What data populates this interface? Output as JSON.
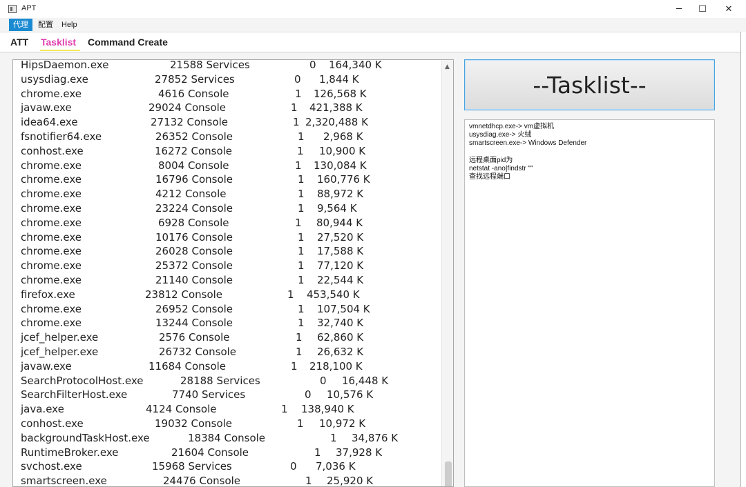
{
  "window": {
    "title": "APT",
    "minimize_glyph": "─",
    "maximize_glyph": "☐",
    "close_glyph": "✕"
  },
  "menu": [
    "代理",
    "配置",
    "Help"
  ],
  "tabs": [
    "ATT",
    "Tasklist",
    "Command Create"
  ],
  "process_list": [
    {
      "name": "HipsDaemon.exe",
      "pid": "21588",
      "session": "Services",
      "num": "0",
      "mem": "164,340 K"
    },
    {
      "name": "usysdiag.exe",
      "pid": "27852",
      "session": "Services",
      "num": "0",
      "mem": "1,844 K"
    },
    {
      "name": "chrome.exe",
      "pid": "4616",
      "session": "Console",
      "num": "1",
      "mem": "126,568 K"
    },
    {
      "name": "javaw.exe",
      "pid": "29024",
      "session": "Console",
      "num": "1",
      "mem": "421,388 K"
    },
    {
      "name": "idea64.exe",
      "pid": "27132",
      "session": "Console",
      "num": "1",
      "mem": "2,320,488 K"
    },
    {
      "name": "fsnotifier64.exe",
      "pid": "26352",
      "session": "Console",
      "num": "1",
      "mem": "2,968 K"
    },
    {
      "name": "conhost.exe",
      "pid": "16272",
      "session": "Console",
      "num": "1",
      "mem": "10,900 K"
    },
    {
      "name": "chrome.exe",
      "pid": "8004",
      "session": "Console",
      "num": "1",
      "mem": "130,084 K"
    },
    {
      "name": "chrome.exe",
      "pid": "16796",
      "session": "Console",
      "num": "1",
      "mem": "160,776 K"
    },
    {
      "name": "chrome.exe",
      "pid": "4212",
      "session": "Console",
      "num": "1",
      "mem": "88,972 K"
    },
    {
      "name": "chrome.exe",
      "pid": "23224",
      "session": "Console",
      "num": "1",
      "mem": "9,564 K"
    },
    {
      "name": "chrome.exe",
      "pid": "6928",
      "session": "Console",
      "num": "1",
      "mem": "80,944 K"
    },
    {
      "name": "chrome.exe",
      "pid": "10176",
      "session": "Console",
      "num": "1",
      "mem": "27,520 K"
    },
    {
      "name": "chrome.exe",
      "pid": "26028",
      "session": "Console",
      "num": "1",
      "mem": "17,588 K"
    },
    {
      "name": "chrome.exe",
      "pid": "25372",
      "session": "Console",
      "num": "1",
      "mem": "77,120 K"
    },
    {
      "name": "chrome.exe",
      "pid": "21140",
      "session": "Console",
      "num": "1",
      "mem": "22,544 K"
    },
    {
      "name": "firefox.exe",
      "pid": "23812",
      "session": "Console",
      "num": "1",
      "mem": "453,540 K"
    },
    {
      "name": "chrome.exe",
      "pid": "26952",
      "session": "Console",
      "num": "1",
      "mem": "107,504 K"
    },
    {
      "name": "chrome.exe",
      "pid": "13244",
      "session": "Console",
      "num": "1",
      "mem": "32,740 K"
    },
    {
      "name": "jcef_helper.exe",
      "pid": "2576",
      "session": "Console",
      "num": "1",
      "mem": "62,860 K"
    },
    {
      "name": "jcef_helper.exe",
      "pid": "26732",
      "session": "Console",
      "num": "1",
      "mem": "26,632 K"
    },
    {
      "name": "javaw.exe",
      "pid": "11684",
      "session": "Console",
      "num": "1",
      "mem": "218,100 K"
    },
    {
      "name": "SearchProtocolHost.exe",
      "pid": "28188",
      "session": "Services",
      "num": "0",
      "mem": "16,448 K"
    },
    {
      "name": "SearchFilterHost.exe",
      "pid": "7740",
      "session": "Services",
      "num": "0",
      "mem": "10,576 K"
    },
    {
      "name": "java.exe",
      "pid": "4124",
      "session": "Console",
      "num": "1",
      "mem": "138,940 K"
    },
    {
      "name": "conhost.exe",
      "pid": "19032",
      "session": "Console",
      "num": "1",
      "mem": "10,972 K"
    },
    {
      "name": "backgroundTaskHost.exe",
      "pid": "18384",
      "session": "Console",
      "num": "1",
      "mem": "34,876 K"
    },
    {
      "name": "RuntimeBroker.exe",
      "pid": "21604",
      "session": "Console",
      "num": "1",
      "mem": "37,928 K"
    },
    {
      "name": "svchost.exe",
      "pid": "15968",
      "session": "Services",
      "num": "0",
      "mem": "7,036 K"
    },
    {
      "name": "smartscreen.exe",
      "pid": "24476",
      "session": "Console",
      "num": "1",
      "mem": "25,920 K"
    }
  ],
  "tasklist_button": "--Tasklist--",
  "notes_text": "vmnetdhcp.exe-> vm虚拟机\nusysdiag.exe-> 火绒\nsmartscreen.exe-> Windows Defender\n\n远程桌面pid为\nnetstat -ano|findstr \"\"\n查找远程端口",
  "scroll_up_glyph": "▲"
}
